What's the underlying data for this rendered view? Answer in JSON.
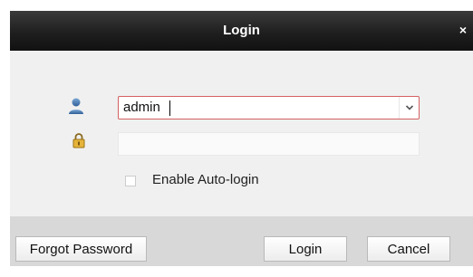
{
  "window": {
    "title": "Login",
    "close_icon": "close-icon"
  },
  "form": {
    "username": {
      "icon": "user-icon",
      "value": "admin",
      "dropdown_icon": "chevron-down-icon"
    },
    "password": {
      "icon": "lock-icon",
      "value": ""
    },
    "auto_login": {
      "label": "Enable Auto-login",
      "checked": false
    }
  },
  "buttons": {
    "forgot_password": "Forgot Password",
    "login": "Login",
    "cancel": "Cancel"
  },
  "colors": {
    "titlebar": "#1f1f1f",
    "dialog_bg": "#efefef",
    "footer_bg": "#d8d8d8",
    "username_border": "#d46060"
  }
}
